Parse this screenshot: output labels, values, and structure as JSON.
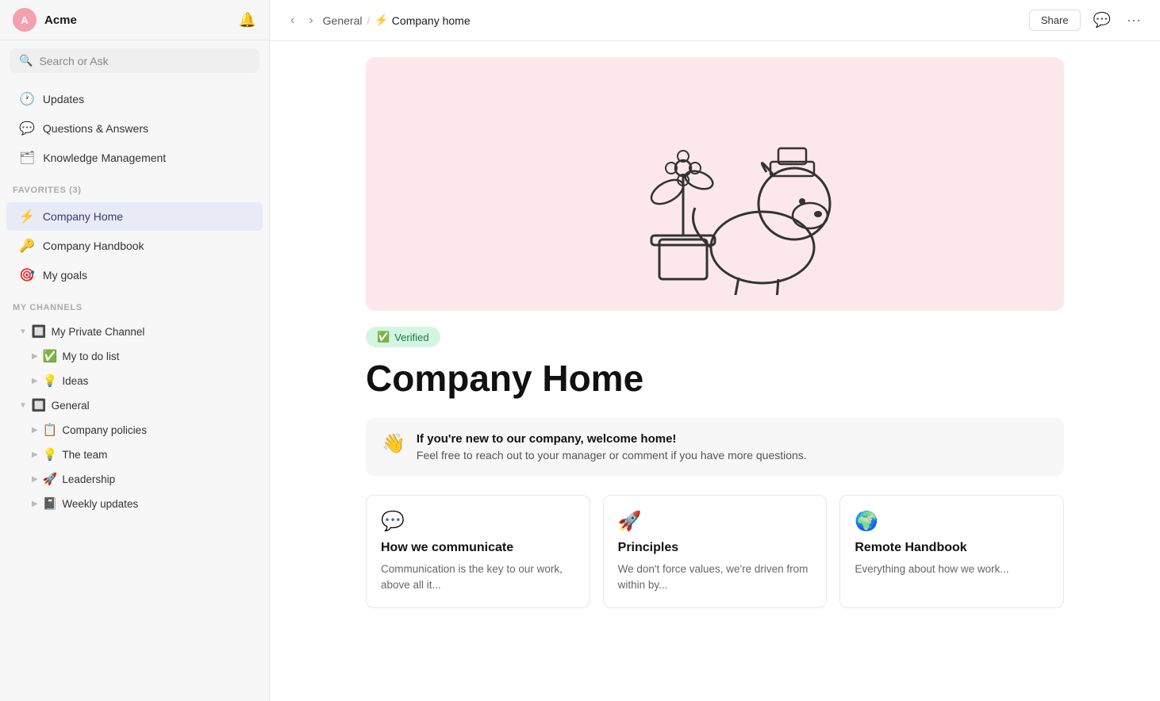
{
  "sidebar": {
    "workspace": {
      "name": "Acme",
      "avatar_letter": "A"
    },
    "search": {
      "placeholder": "Search or Ask"
    },
    "nav_items": [
      {
        "id": "updates",
        "label": "Updates",
        "icon": "🕐"
      },
      {
        "id": "qa",
        "label": "Questions & Answers",
        "icon": "💬"
      },
      {
        "id": "km",
        "label": "Knowledge Management",
        "icon": "🗂"
      }
    ],
    "favorites_section_label": "FAVORITES (3)",
    "favorites": [
      {
        "id": "company-home",
        "label": "Company Home",
        "icon": "⚡"
      },
      {
        "id": "company-handbook",
        "label": "Company Handbook",
        "icon": "🔑"
      },
      {
        "id": "my-goals",
        "label": "My goals",
        "icon": "🎯"
      }
    ],
    "channels_section_label": "MY CHANNELS",
    "channels": [
      {
        "id": "my-private-channel",
        "label": "My Private Channel",
        "icon": "🔲",
        "expanded": true,
        "children": [
          {
            "id": "my-todo",
            "label": "My to do list",
            "icon": "✅"
          },
          {
            "id": "ideas",
            "label": "Ideas",
            "icon": "💡"
          }
        ]
      },
      {
        "id": "general",
        "label": "General",
        "icon": "🔲",
        "expanded": true,
        "children": [
          {
            "id": "company-policies",
            "label": "Company policies",
            "icon": "📋"
          },
          {
            "id": "the-team",
            "label": "The team",
            "icon": "💡"
          },
          {
            "id": "leadership",
            "label": "Leadership",
            "icon": "🚀"
          },
          {
            "id": "weekly-updates",
            "label": "Weekly updates",
            "icon": "📓"
          }
        ]
      }
    ]
  },
  "topbar": {
    "back_title": "Back",
    "forward_title": "Forward",
    "breadcrumb_parent": "General",
    "breadcrumb_separator": "/",
    "breadcrumb_current_icon": "⚡",
    "breadcrumb_current": "Company home",
    "share_label": "Share",
    "comment_icon": "💬",
    "more_icon": "···"
  },
  "page": {
    "verified_label": "Verified",
    "title": "Company Home",
    "welcome": {
      "emoji": "👋",
      "title": "If you're new to our company, welcome home!",
      "body": "Feel free to reach out to your manager or comment if you have more questions."
    },
    "cards": [
      {
        "id": "how-we-communicate",
        "icon": "💬",
        "title": "How we communicate",
        "body": "Communication is the key to our work, above all it..."
      },
      {
        "id": "principles",
        "icon": "🚀",
        "title": "Principles",
        "body": "We don't force values, we're driven from within by..."
      },
      {
        "id": "remote-handbook",
        "icon": "🌍",
        "title": "Remote Handbook",
        "body": "Everything about how we work..."
      }
    ]
  }
}
